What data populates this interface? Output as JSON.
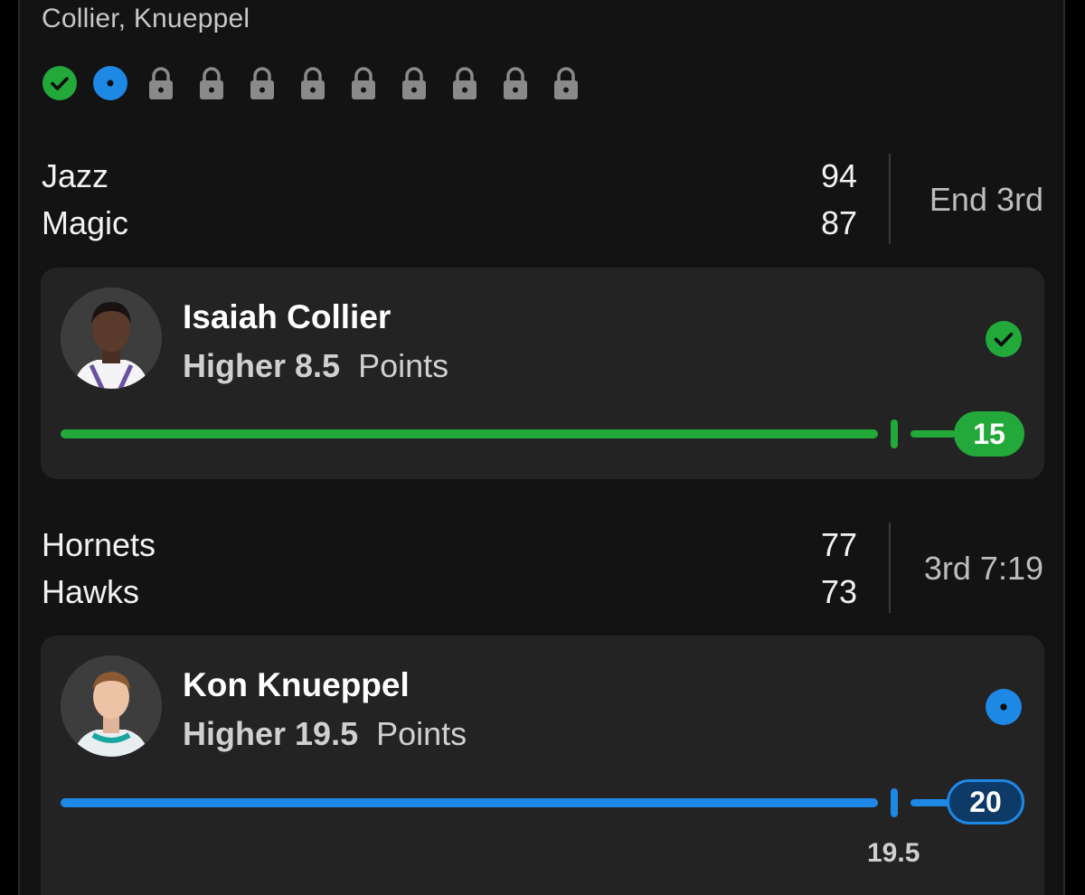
{
  "header": {
    "subtitle": "Collier, Knueppel"
  },
  "status_icons": [
    {
      "state": "won",
      "icon": "check-circle-icon",
      "color": "#22a93a"
    },
    {
      "state": "live",
      "icon": "live-dot-icon",
      "color": "#1e88e5"
    },
    {
      "state": "locked",
      "icon": "lock-icon",
      "color": "#8a8a8a"
    },
    {
      "state": "locked",
      "icon": "lock-icon",
      "color": "#8a8a8a"
    },
    {
      "state": "locked",
      "icon": "lock-icon",
      "color": "#8a8a8a"
    },
    {
      "state": "locked",
      "icon": "lock-icon",
      "color": "#8a8a8a"
    },
    {
      "state": "locked",
      "icon": "lock-icon",
      "color": "#8a8a8a"
    },
    {
      "state": "locked",
      "icon": "lock-icon",
      "color": "#8a8a8a"
    },
    {
      "state": "locked",
      "icon": "lock-icon",
      "color": "#8a8a8a"
    },
    {
      "state": "locked",
      "icon": "lock-icon",
      "color": "#8a8a8a"
    },
    {
      "state": "locked",
      "icon": "lock-icon",
      "color": "#8a8a8a"
    }
  ],
  "games": [
    {
      "home": {
        "name": "Jazz",
        "score": "94"
      },
      "away": {
        "name": "Magic",
        "score": "87"
      },
      "clock": "End 3rd"
    },
    {
      "home": {
        "name": "Hornets",
        "score": "77"
      },
      "away": {
        "name": "Hawks",
        "score": "73"
      },
      "clock": "3rd 7:19"
    }
  ],
  "picks": [
    {
      "player": "Isaiah Collier",
      "direction": "Higher",
      "line": "8.5",
      "stat": "Points",
      "current": "15",
      "status": "won",
      "status_icon": "check-circle-icon",
      "color": "#22a93a",
      "progress": 1.0
    },
    {
      "player": "Kon Knueppel",
      "direction": "Higher",
      "line": "19.5",
      "stat": "Points",
      "current": "20",
      "status": "live",
      "status_icon": "live-dot-icon",
      "color": "#1e88e5",
      "progress": 1.0,
      "line_caption": "19.5"
    }
  ]
}
